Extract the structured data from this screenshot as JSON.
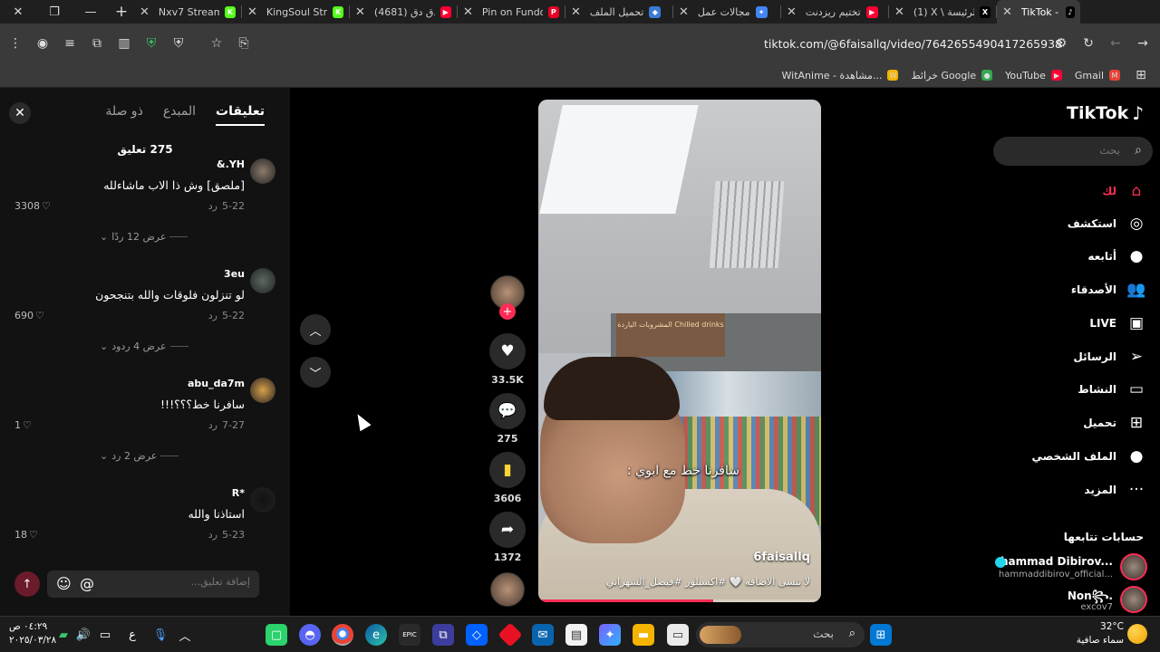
{
  "browser": {
    "tabs": [
      {
        "title": "Nxv7 Stream",
        "fav": "K",
        "color": "#53fc18"
      },
      {
        "title": "KingSoul Stre",
        "fav": "K",
        "color": "#53fc18"
      },
      {
        "title": "(4681) دق دق",
        "fav": "▶",
        "color": "#ff0033"
      },
      {
        "title": "Pin on Fundo",
        "fav": "P",
        "color": "#e60023"
      },
      {
        "title": "تحميل الملف",
        "fav": "◆",
        "color": "#3a7bd5"
      },
      {
        "title": "مجالات عمل",
        "fav": "✦",
        "color": "#4285f4"
      },
      {
        "title": "تختيم ريزدنت",
        "fav": "▶",
        "color": "#ff0033"
      },
      {
        "title": "(1) X \\ الرئيسة",
        "fav": "X",
        "color": "#000000"
      },
      {
        "title": "TikTok - M",
        "fav": "♪",
        "color": "#000000"
      }
    ],
    "url": "tiktok.com/@6faisallq/video/7642655490417265938",
    "bookmarks": [
      {
        "label": "Gmail",
        "fav": "M",
        "color": "#ea4335"
      },
      {
        "label": "YouTube",
        "fav": "▶",
        "color": "#ff0033"
      },
      {
        "label": "خرائط Google",
        "fav": "●",
        "color": "#34a853"
      },
      {
        "label": "WitAnime - مشاهدة...",
        "fav": "W",
        "color": "#f5b400"
      }
    ]
  },
  "comments_panel": {
    "tabs": [
      "تعليقات",
      "المبدع",
      "ذو صلة"
    ],
    "count": "275 تعليق",
    "reply_label": "رد",
    "items": [
      {
        "user": "&.YH",
        "text": "[ملصق] وش ذا الاب ماشاءلله",
        "date": "5-22",
        "likes": "3308",
        "more": "عرض 12 ردًا",
        "avatar": "#8d7b6a"
      },
      {
        "user": "3eu",
        "text": "لو تنزلون فلوقات والله بتنجحون",
        "date": "5-22",
        "likes": "690",
        "more": "عرض 4 ردود",
        "avatar": "#5b6a5f"
      },
      {
        "user": "abu_da7m",
        "text": "سافرنا خط؟؟؟!!!",
        "date": "7-27",
        "likes": "1",
        "more": "عرض 2 رد",
        "avatar": "#d9a04a"
      },
      {
        "user": "R*",
        "text": "استاذنا والله",
        "date": "5-23",
        "likes": "18",
        "more": "",
        "avatar": "#121212"
      }
    ],
    "input_placeholder": "إضافة تعليق..."
  },
  "video": {
    "caption": "سافرنا خط مع ابوي :",
    "username": "6faisallq",
    "description": "لا تنسى الاضافه 🤍 #اكسبلور #فيصل_الشهراني",
    "progress": 0.62,
    "sign_text": "المشروبات الباردة Chilled drinks"
  },
  "actions": {
    "likes": "33.5K",
    "comments": "275",
    "saves": "3606",
    "shares": "1372"
  },
  "sidebar": {
    "logo": "TikTok",
    "search_placeholder": "بحث",
    "nav": [
      {
        "label": "لك",
        "icon": "⌂",
        "name": "home"
      },
      {
        "label": "استكشف",
        "icon": "◎",
        "name": "explore"
      },
      {
        "label": "أتابعه",
        "icon": "●",
        "name": "following"
      },
      {
        "label": "الأصدقاء",
        "icon": "👥",
        "name": "friends"
      },
      {
        "label": "LIVE",
        "icon": "▣",
        "name": "live"
      },
      {
        "label": "الرسائل",
        "icon": "➢",
        "name": "messages"
      },
      {
        "label": "النشاط",
        "icon": "▭",
        "name": "activity"
      },
      {
        "label": "تحميل",
        "icon": "⊞",
        "name": "upload"
      },
      {
        "label": "الملف الشخصي",
        "icon": "●",
        "name": "profile"
      },
      {
        "label": "المزيد",
        "icon": "···",
        "name": "more"
      }
    ],
    "following_title": "حسابات تتابعها",
    "following": [
      {
        "name": "hammad Dibirov...",
        "handle": "hammaddibirov_official..."
      },
      {
        "name": "Non꧂.",
        "handle": "excov7"
      }
    ]
  },
  "taskbar": {
    "search_label": "بحث",
    "weather_temp": "32°C",
    "weather_desc": "سماء صافية",
    "time": "٠٤:٢٩ ص",
    "date": "٢٠٢٥/٠٣/٢٨",
    "lang": "ع"
  }
}
